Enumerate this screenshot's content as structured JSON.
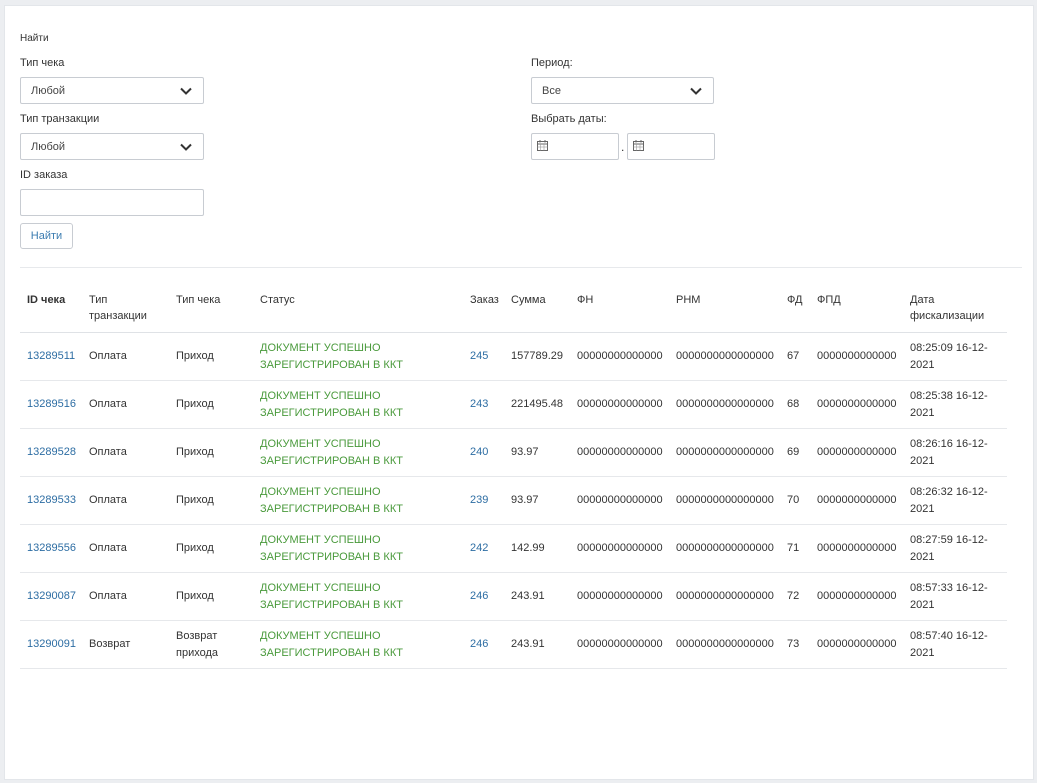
{
  "filters": {
    "title": "Найти",
    "receipt_type": {
      "label": "Тип чека",
      "value": "Любой"
    },
    "transaction_type": {
      "label": "Тип транзакции",
      "value": "Любой"
    },
    "order_id": {
      "label": "ID заказа",
      "value": ""
    },
    "period": {
      "label": "Период:",
      "value": "Все"
    },
    "dates": {
      "label": "Выбрать даты:",
      "from": "",
      "to": "",
      "separator": "."
    },
    "find_button": "Найти"
  },
  "table": {
    "headers": {
      "id": "ID чека",
      "transaction_type": "Тип транзакции",
      "receipt_type": "Тип чека",
      "status": "Статус",
      "order": "Заказ",
      "amount": "Сумма",
      "fn": "ФН",
      "rnm": "РНМ",
      "fd": "ФД",
      "fpd": "ФПД",
      "date": "Дата фискализации"
    },
    "rows": [
      {
        "id": "13289511",
        "transaction_type": "Оплата",
        "receipt_type": "Приход",
        "status": "ДОКУМЕНТ УСПЕШНО ЗАРЕГИСТРИРОВАН В ККТ",
        "order": "245",
        "amount": "157789.29",
        "fn": "00000000000000",
        "rnm": "0000000000000000",
        "fd": "67",
        "fpd": "0000000000000",
        "date": "08:25:09 16-12-2021"
      },
      {
        "id": "13289516",
        "transaction_type": "Оплата",
        "receipt_type": "Приход",
        "status": "ДОКУМЕНТ УСПЕШНО ЗАРЕГИСТРИРОВАН В ККТ",
        "order": "243",
        "amount": "221495.48",
        "fn": "00000000000000",
        "rnm": "0000000000000000",
        "fd": "68",
        "fpd": "0000000000000",
        "date": "08:25:38 16-12-2021"
      },
      {
        "id": "13289528",
        "transaction_type": "Оплата",
        "receipt_type": "Приход",
        "status": "ДОКУМЕНТ УСПЕШНО ЗАРЕГИСТРИРОВАН В ККТ",
        "order": "240",
        "amount": "93.97",
        "fn": "00000000000000",
        "rnm": "0000000000000000",
        "fd": "69",
        "fpd": "0000000000000",
        "date": "08:26:16 16-12-2021"
      },
      {
        "id": "13289533",
        "transaction_type": "Оплата",
        "receipt_type": "Приход",
        "status": "ДОКУМЕНТ УСПЕШНО ЗАРЕГИСТРИРОВАН В ККТ",
        "order": "239",
        "amount": "93.97",
        "fn": "00000000000000",
        "rnm": "0000000000000000",
        "fd": "70",
        "fpd": "0000000000000",
        "date": "08:26:32 16-12-2021"
      },
      {
        "id": "13289556",
        "transaction_type": "Оплата",
        "receipt_type": "Приход",
        "status": "ДОКУМЕНТ УСПЕШНО ЗАРЕГИСТРИРОВАН В ККТ",
        "order": "242",
        "amount": "142.99",
        "fn": "00000000000000",
        "rnm": "0000000000000000",
        "fd": "71",
        "fpd": "0000000000000",
        "date": "08:27:59 16-12-2021"
      },
      {
        "id": "13290087",
        "transaction_type": "Оплата",
        "receipt_type": "Приход",
        "status": "ДОКУМЕНТ УСПЕШНО ЗАРЕГИСТРИРОВАН В ККТ",
        "order": "246",
        "amount": "243.91",
        "fn": "00000000000000",
        "rnm": "0000000000000000",
        "fd": "72",
        "fpd": "0000000000000",
        "date": "08:57:33 16-12-2021"
      },
      {
        "id": "13290091",
        "transaction_type": "Возврат",
        "receipt_type": "Возврат прихода",
        "status": "ДОКУМЕНТ УСПЕШНО ЗАРЕГИСТРИРОВАН В ККТ",
        "order": "246",
        "amount": "243.91",
        "fn": "00000000000000",
        "rnm": "0000000000000000",
        "fd": "73",
        "fpd": "0000000000000",
        "date": "08:57:40 16-12-2021"
      }
    ]
  },
  "colors": {
    "link": "#2d6da3",
    "status_ok": "#4a9a3c"
  }
}
